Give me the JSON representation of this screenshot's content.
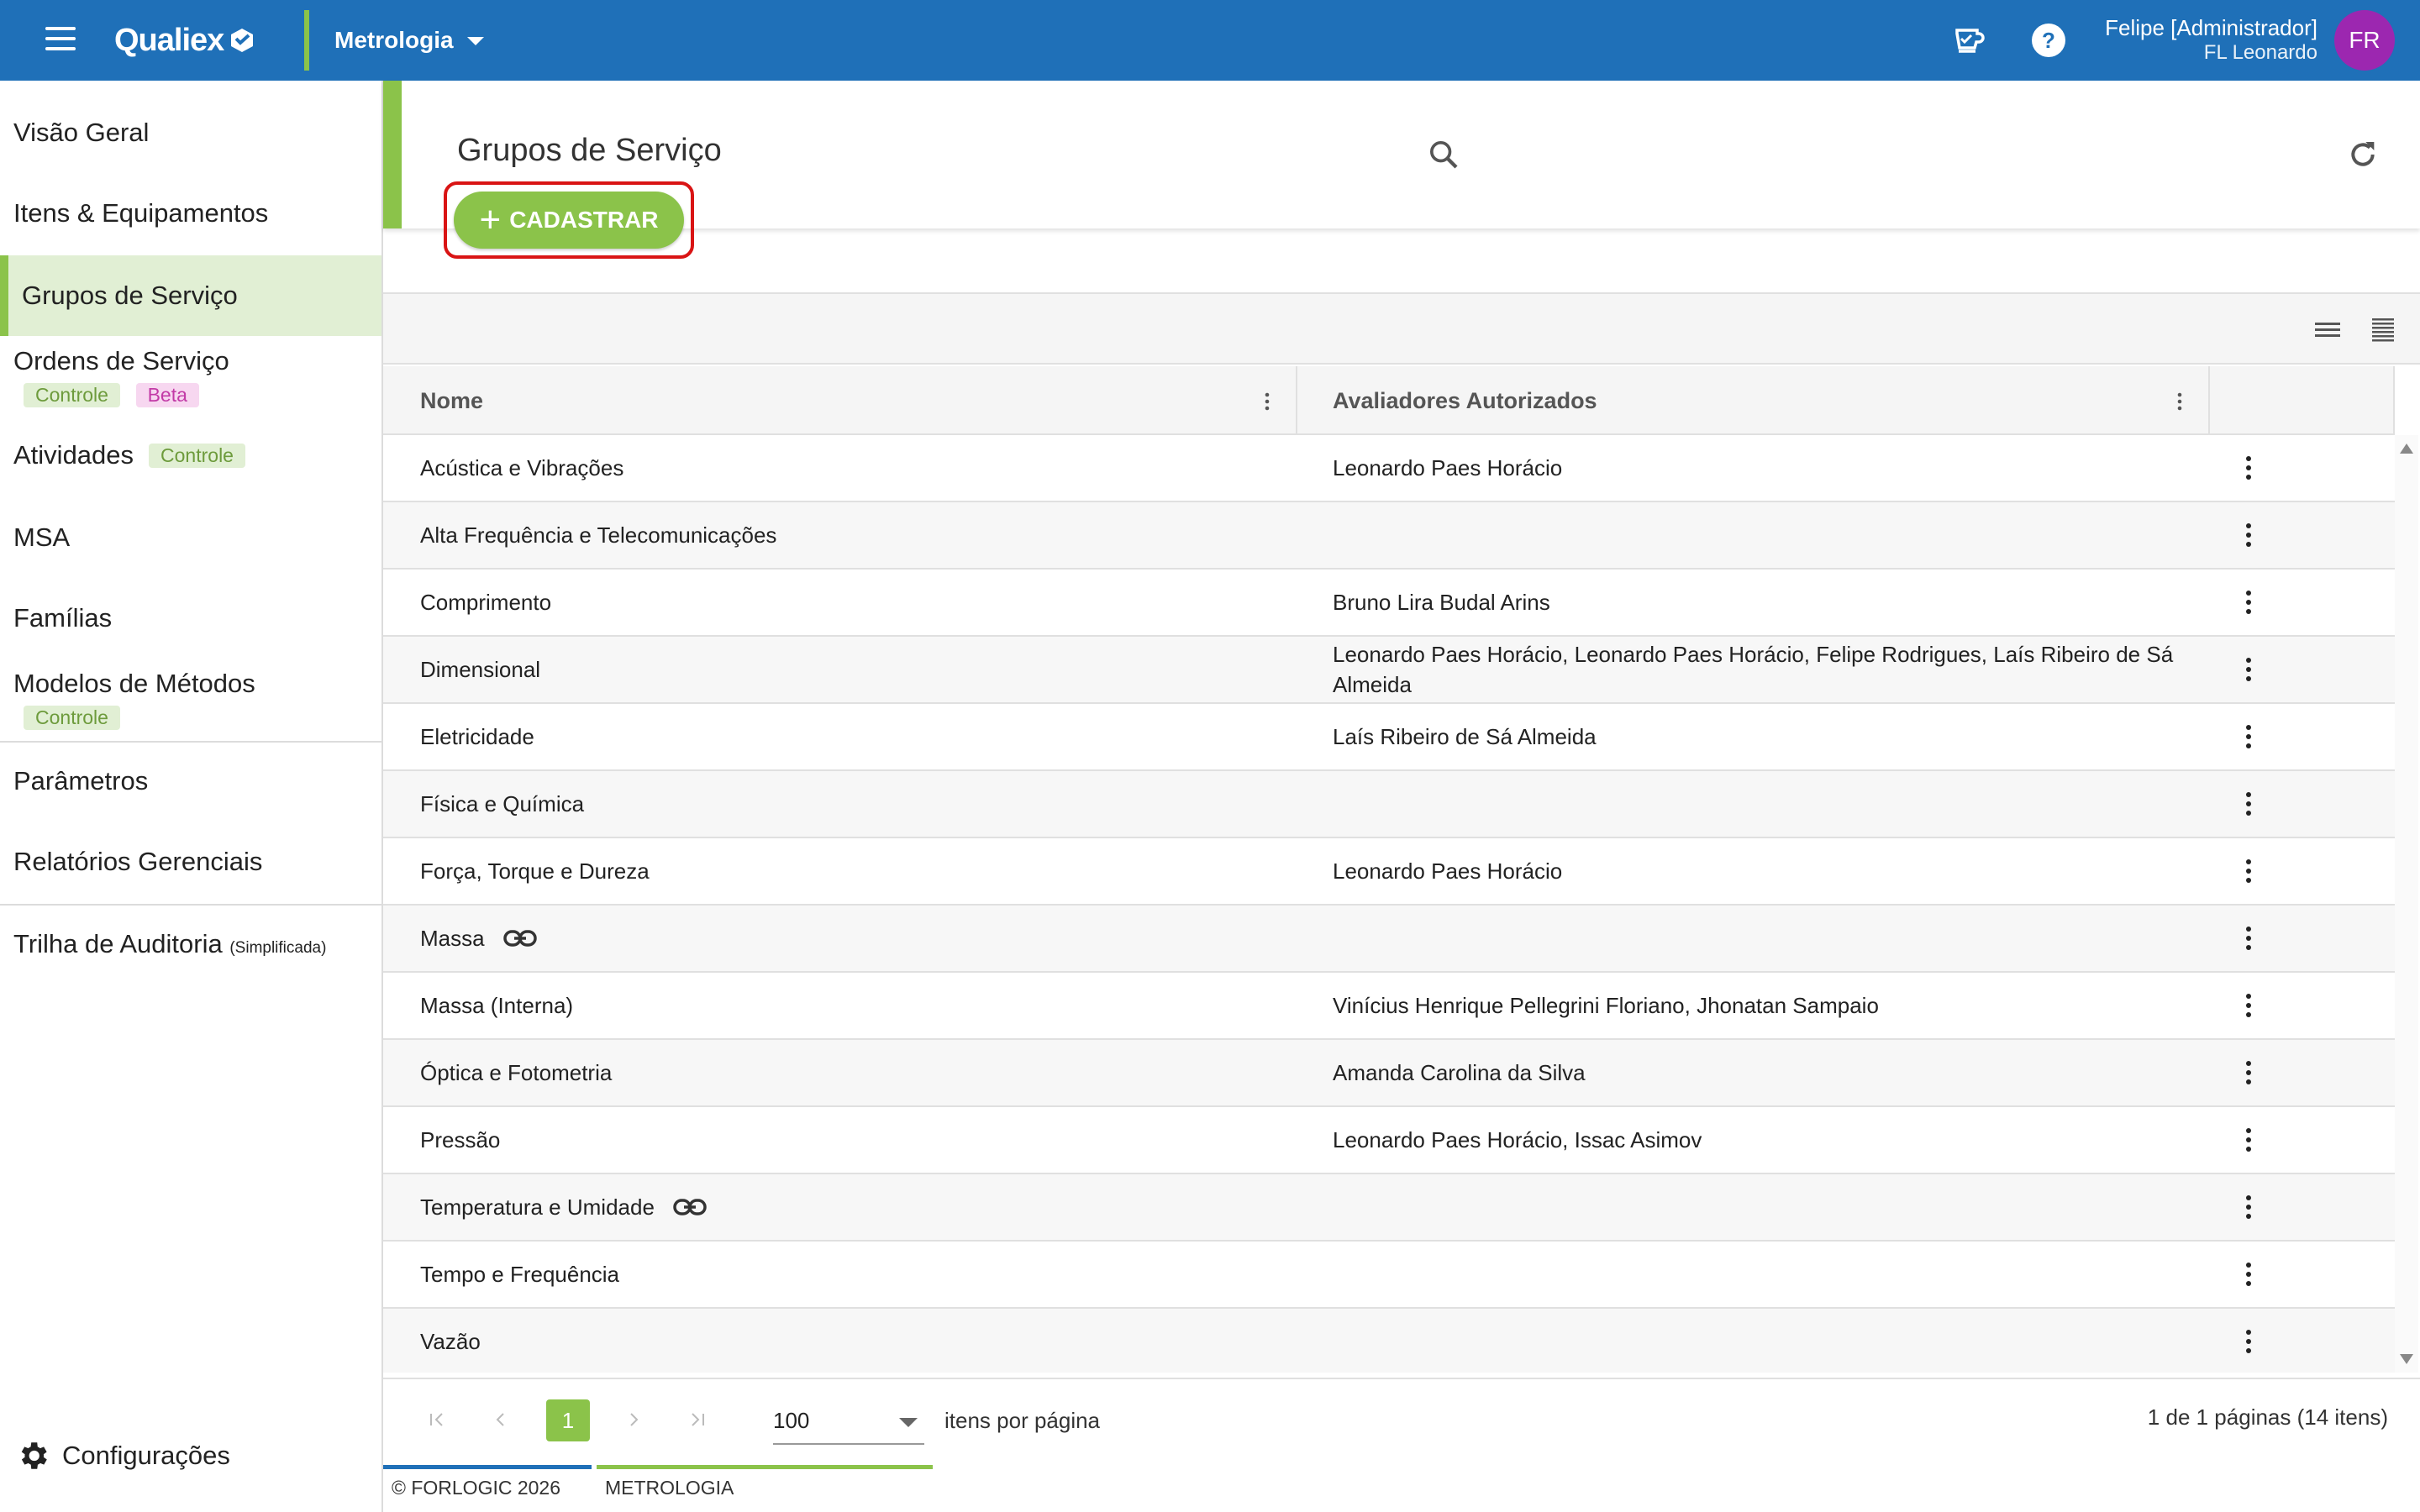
{
  "topbar": {
    "brand": "Qualiex",
    "module": "Metrologia",
    "user_name": "Felipe [Administrador]",
    "user_sub": "FL Leonardo",
    "avatar_initials": "FR",
    "colors": {
      "bar": "#1f70b8",
      "accent": "#8bc34a",
      "avatar": "#9c27b0"
    },
    "icons": [
      "menu-icon",
      "coffee-cup-icon",
      "help-icon"
    ]
  },
  "sidebar": {
    "items": [
      {
        "label": "Visão Geral"
      },
      {
        "label": "Itens & Equipamentos"
      },
      {
        "label": "Grupos de Serviço",
        "active": true
      },
      {
        "label": "Ordens de Serviço",
        "chip1": "Controle",
        "chip2": "Beta"
      },
      {
        "label": "Atividades",
        "chip1": "Controle"
      },
      {
        "label": "MSA"
      },
      {
        "label": "Famílias"
      },
      {
        "label": "Modelos de Métodos",
        "chip1": "Controle"
      },
      {
        "label": "Parâmetros"
      },
      {
        "label": "Relatórios Gerenciais"
      },
      {
        "label": "Trilha de Auditoria",
        "note": "(Simplificada)"
      }
    ],
    "settings_label": "Configurações"
  },
  "main": {
    "title": "Grupos de Serviço",
    "add_label": "CADASTRAR"
  },
  "table": {
    "columns": [
      "Nome",
      "Avaliadores Autorizados"
    ],
    "rows": [
      {
        "nome": "Acústica e Vibrações",
        "avaliadores": "Leonardo Paes Horácio"
      },
      {
        "nome": "Alta Frequência e Telecomunicações",
        "avaliadores": ""
      },
      {
        "nome": "Comprimento",
        "avaliadores": "Bruno Lira Budal Arins"
      },
      {
        "nome": "Dimensional",
        "avaliadores": "Leonardo Paes Horácio, Leonardo Paes Horácio, Felipe Rodrigues, Laís Ribeiro de Sá Almeida"
      },
      {
        "nome": "Eletricidade",
        "avaliadores": "Laís Ribeiro de Sá Almeida"
      },
      {
        "nome": "Física e Química",
        "avaliadores": ""
      },
      {
        "nome": "Força, Torque e Dureza",
        "avaliadores": "Leonardo Paes Horácio"
      },
      {
        "nome": "Massa",
        "avaliadores": "",
        "linked": true
      },
      {
        "nome": "Massa (Interna)",
        "avaliadores": "Vinícius Henrique Pellegrini Floriano, Jhonatan Sampaio"
      },
      {
        "nome": "Óptica e Fotometria",
        "avaliadores": "Amanda Carolina da Silva"
      },
      {
        "nome": "Pressão",
        "avaliadores": "Leonardo Paes Horácio, Issac Asimov"
      },
      {
        "nome": "Temperatura e Umidade",
        "avaliadores": "",
        "linked": true
      },
      {
        "nome": "Tempo e Frequência",
        "avaliadores": ""
      },
      {
        "nome": "Vazão",
        "avaliadores": ""
      }
    ]
  },
  "pager": {
    "current_page": "1",
    "page_size": "100",
    "per_page_label": "itens por página",
    "info": "1 de 1 páginas (14 itens)"
  },
  "footer": {
    "copyright": "© FORLOGIC 2026",
    "module": "METROLOGIA"
  }
}
